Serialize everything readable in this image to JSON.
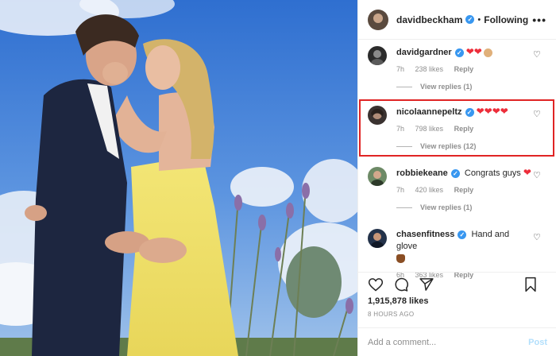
{
  "post": {
    "author": "davidbeckham",
    "separator": "•",
    "follow_status": "Following",
    "more_glyph": "•••",
    "likes_count": "1,915,878 likes",
    "time_ago": "8 HOURS AGO"
  },
  "comments": [
    {
      "user": "davidgardner",
      "text": "",
      "emoji": "❤❤",
      "time": "7h",
      "likes": "238 likes",
      "reply_label": "Reply",
      "replies": "View replies (1)",
      "highlighted": false
    },
    {
      "user": "nicolaannepeltz",
      "text": "",
      "emoji": "❤❤❤❤",
      "time": "7h",
      "likes": "798 likes",
      "reply_label": "Reply",
      "replies": "View replies (12)",
      "highlighted": true
    },
    {
      "user": "robbiekeane",
      "text": "Congrats guys",
      "emoji": "❤",
      "time": "7h",
      "likes": "420 likes",
      "reply_label": "Reply",
      "replies": "View replies (1)",
      "highlighted": false
    },
    {
      "user": "chasenfitness",
      "text": "Hand and glove",
      "emoji": "",
      "time": "6h",
      "likes": "363 likes",
      "reply_label": "Reply",
      "replies": "",
      "highlighted": false
    }
  ],
  "composer": {
    "placeholder": "Add a comment...",
    "post_label": "Post"
  },
  "icons": {
    "like": "heart-icon",
    "comment": "comment-icon",
    "share": "share-icon",
    "save": "bookmark-icon",
    "verified": "verified-badge-icon"
  },
  "colors": {
    "verified": "#3897f0",
    "highlight_box": "#e02424",
    "heart": "#ed2d3a",
    "muted": "#8e8e8e"
  }
}
